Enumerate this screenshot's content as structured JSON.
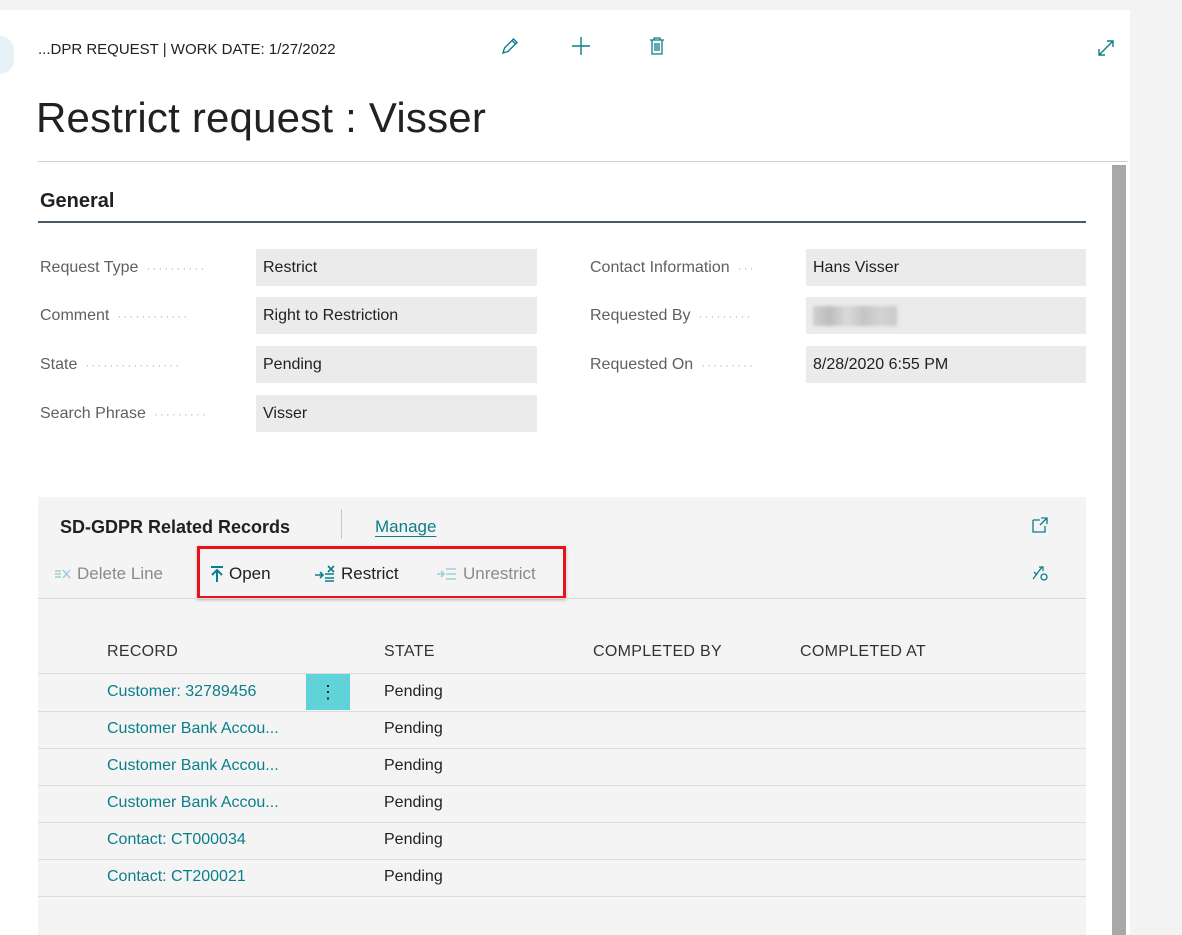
{
  "header": {
    "breadcrumb": "...DPR REQUEST | WORK DATE: 1/27/2022",
    "page_title": "Restrict request : Visser",
    "icons": [
      "edit-icon",
      "plus-icon",
      "delete-icon",
      "expand-icon"
    ]
  },
  "general": {
    "header": "General",
    "left_fields": [
      {
        "label": "Request Type",
        "value": "Restrict"
      },
      {
        "label": "Comment",
        "value": "Right to Restriction"
      },
      {
        "label": "State",
        "value": "Pending"
      },
      {
        "label": "Search Phrase",
        "value": "Visser"
      }
    ],
    "right_fields": [
      {
        "label": "Contact Information",
        "value": "Hans Visser"
      },
      {
        "label": "Requested By",
        "value": ""
      },
      {
        "label": "Requested On",
        "value": "8/28/2020 6:55 PM"
      }
    ]
  },
  "related": {
    "title": "SD-GDPR Related Records",
    "manage_label": "Manage",
    "actions": {
      "delete_line": "Delete Line",
      "open": "Open",
      "restrict": "Restrict",
      "unrestrict": "Unrestrict"
    },
    "columns": [
      "RECORD",
      "STATE",
      "COMPLETED BY",
      "COMPLETED AT"
    ],
    "rows": [
      {
        "record": "Customer: 32789456",
        "state": "Pending",
        "completed_by": "",
        "completed_at": ""
      },
      {
        "record": "Customer Bank Accou...",
        "state": "Pending",
        "completed_by": "",
        "completed_at": ""
      },
      {
        "record": "Customer Bank Accou...",
        "state": "Pending",
        "completed_by": "",
        "completed_at": ""
      },
      {
        "record": "Customer Bank Accou...",
        "state": "Pending",
        "completed_by": "",
        "completed_at": ""
      },
      {
        "record": "Contact: CT000034",
        "state": "Pending",
        "completed_by": "",
        "completed_at": ""
      },
      {
        "record": "Contact: CT200021",
        "state": "Pending",
        "completed_by": "",
        "completed_at": ""
      }
    ],
    "row_menu_glyph": "⋮"
  },
  "colors": {
    "accent": "#0a7e8a",
    "highlight": "#e8121b",
    "row_menu": "#5fd3d8"
  }
}
